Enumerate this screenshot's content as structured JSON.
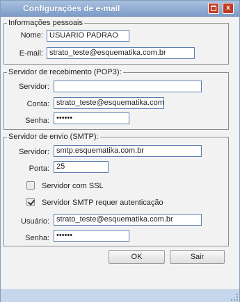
{
  "window": {
    "title": "Configurações de e-mail",
    "maximize_icon": "maximize-icon",
    "close_icon": "close-icon",
    "close_glyph": "x"
  },
  "personal": {
    "legend": "Informações pessoais",
    "name_label": "Nome:",
    "name_value": "USUARIO PADRAO",
    "email_label": "E-mail:",
    "email_value": "strato_teste@esquematika.com.br"
  },
  "pop3": {
    "legend": "Servidor de recebimento (POP3):",
    "server_label": "Servidor:",
    "server_value": "",
    "account_label": "Conta:",
    "account_value": "strato_teste@esquematika.com.br",
    "password_label": "Senha:",
    "password_value": "••••••"
  },
  "smtp": {
    "legend": "Servidor de envio (SMTP):",
    "server_label": "Servidor:",
    "server_value": "smtp.esquematika.com.br",
    "port_label": "Porta:",
    "port_value": "25",
    "ssl_label": "Servidor com SSL",
    "ssl_checked": false,
    "auth_label": "Servidor SMTP requer autenticação",
    "auth_checked": true,
    "user_label": "Usuário:",
    "user_value": "strato_teste@esquematika.com.br",
    "password_label": "Senha:",
    "password_value": "••••••"
  },
  "buttons": {
    "ok": "OK",
    "exit": "Sair"
  },
  "colors": {
    "title_bar": "#7c9cc8",
    "input_border": "#5a7fb0",
    "close_button": "#c43a23"
  }
}
